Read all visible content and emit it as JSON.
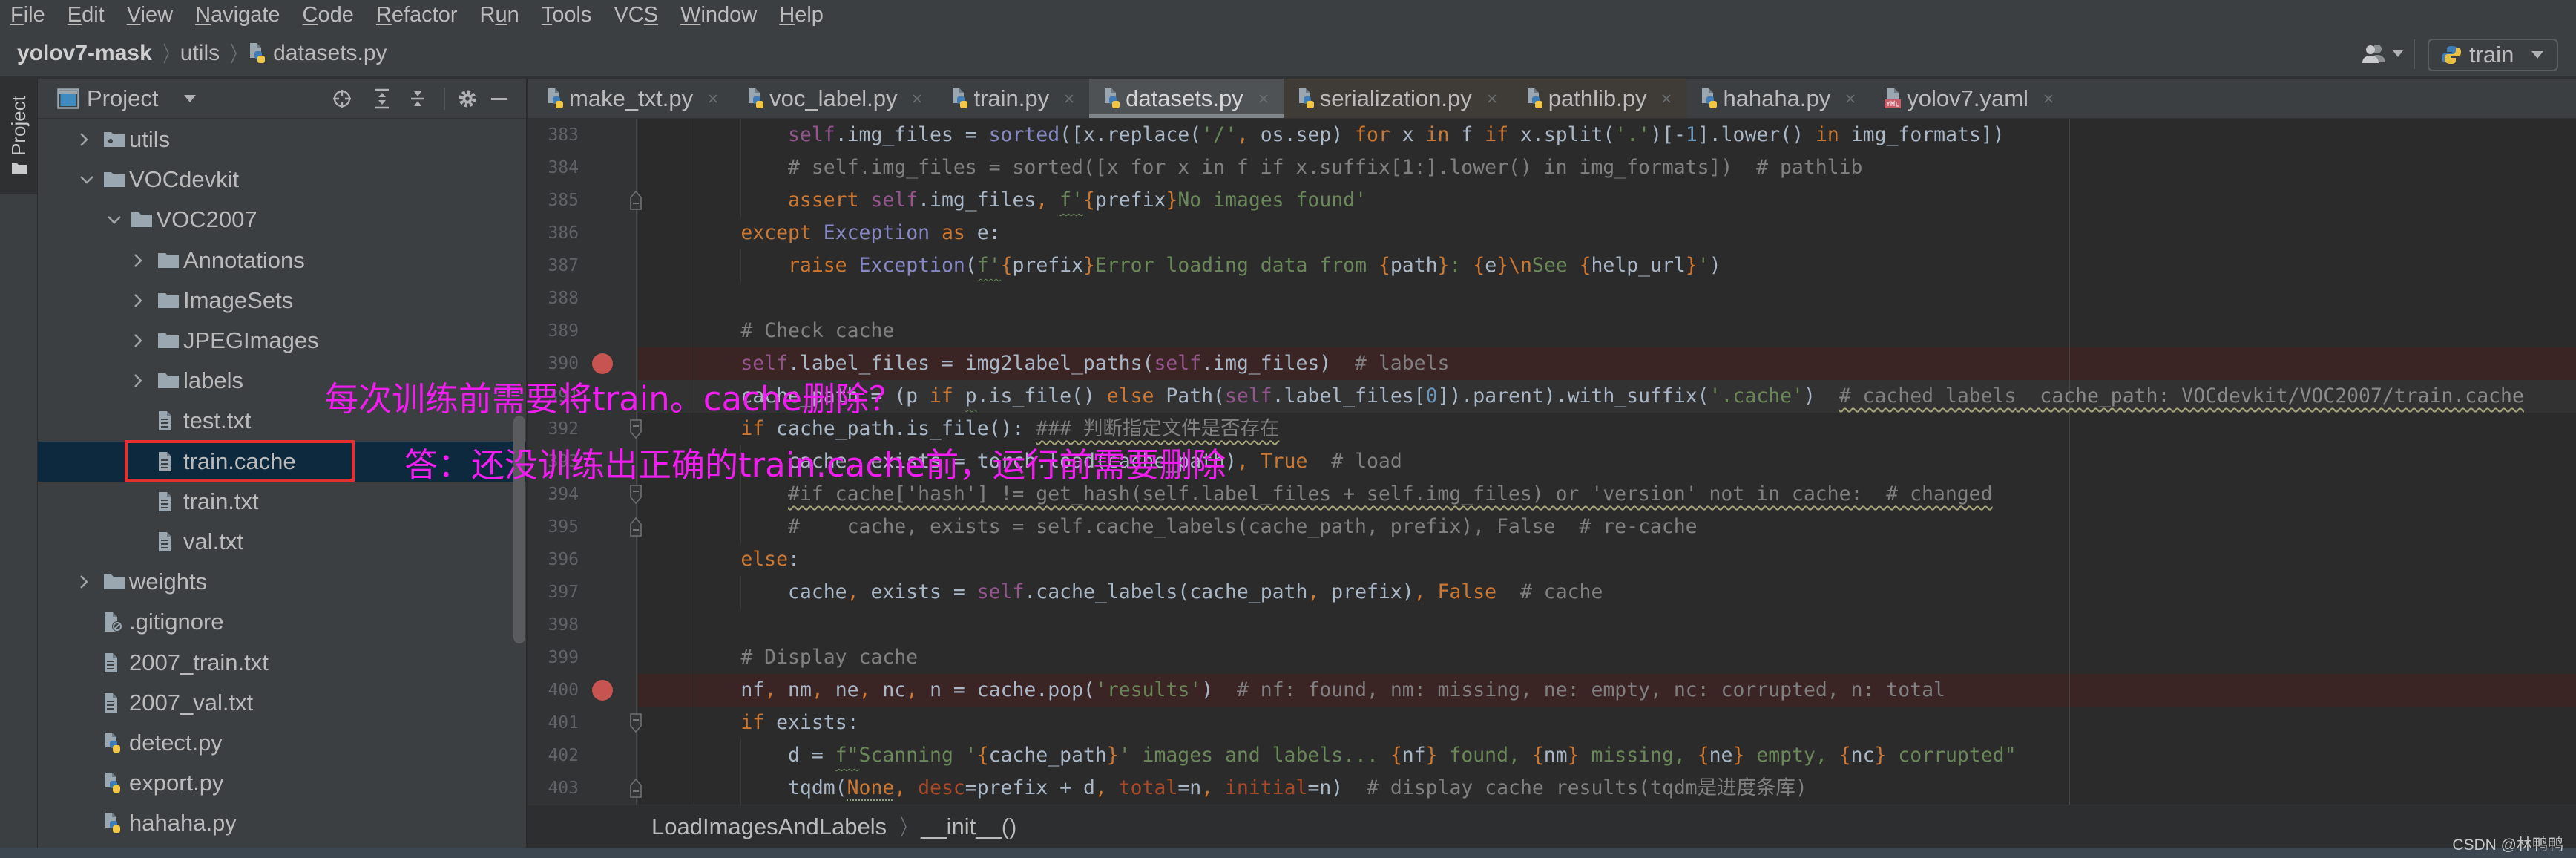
{
  "menu": [
    {
      "label": "File",
      "mnemonic": 0
    },
    {
      "label": "Edit",
      "mnemonic": 0
    },
    {
      "label": "View",
      "mnemonic": 0
    },
    {
      "label": "Navigate",
      "mnemonic": 0
    },
    {
      "label": "Code",
      "mnemonic": 0
    },
    {
      "label": "Refactor",
      "mnemonic": 0
    },
    {
      "label": "Run",
      "mnemonic": 1
    },
    {
      "label": "Tools",
      "mnemonic": 0
    },
    {
      "label": "VCS",
      "mnemonic": 2
    },
    {
      "label": "Window",
      "mnemonic": 0
    },
    {
      "label": "Help",
      "mnemonic": 0
    }
  ],
  "navbar": {
    "project": "yolov7-mask",
    "folder": "utils",
    "file": "datasets.py"
  },
  "toolbar": {
    "run_config": "train"
  },
  "left_strip": {
    "project_tab": "Project"
  },
  "project_panel": {
    "title": "Project",
    "tree": [
      {
        "label": "utils",
        "kind": "package",
        "level": 1,
        "expanded": false
      },
      {
        "label": "VOCdevkit",
        "kind": "folder",
        "level": 1,
        "expanded": true
      },
      {
        "label": "VOC2007",
        "kind": "folder",
        "level": 2,
        "expanded": true
      },
      {
        "label": "Annotations",
        "kind": "folder",
        "level": 3,
        "expanded": false
      },
      {
        "label": "ImageSets",
        "kind": "folder",
        "level": 3,
        "expanded": false
      },
      {
        "label": "JPEGImages",
        "kind": "folder",
        "level": 3,
        "expanded": false
      },
      {
        "label": "labels",
        "kind": "folder",
        "level": 3,
        "expanded": false
      },
      {
        "label": "test.txt",
        "kind": "text",
        "level": 3
      },
      {
        "label": "train.cache",
        "kind": "text",
        "level": 3,
        "selected": true
      },
      {
        "label": "train.txt",
        "kind": "text",
        "level": 3
      },
      {
        "label": "val.txt",
        "kind": "text",
        "level": 3
      },
      {
        "label": "weights",
        "kind": "folder",
        "level": 1,
        "expanded": false
      },
      {
        "label": ".gitignore",
        "kind": "ignore",
        "level": 1
      },
      {
        "label": "2007_train.txt",
        "kind": "text",
        "level": 1
      },
      {
        "label": "2007_val.txt",
        "kind": "text",
        "level": 1
      },
      {
        "label": "detect.py",
        "kind": "python",
        "level": 1
      },
      {
        "label": "export.py",
        "kind": "python",
        "level": 1
      },
      {
        "label": "hahaha.py",
        "kind": "python",
        "level": 1
      }
    ]
  },
  "editor": {
    "tabs": [
      {
        "label": "make_txt.py",
        "icon": "python"
      },
      {
        "label": "voc_label.py",
        "icon": "python"
      },
      {
        "label": "train.py",
        "icon": "python"
      },
      {
        "label": "datasets.py",
        "icon": "python",
        "active": true
      },
      {
        "label": "serialization.py",
        "icon": "python",
        "external": true
      },
      {
        "label": "pathlib.py",
        "icon": "python",
        "external": true
      },
      {
        "label": "hahaha.py",
        "icon": "python"
      },
      {
        "label": "yolov7.yaml",
        "icon": "yaml"
      }
    ],
    "lines": [
      {
        "number": 383,
        "tokens": [
          [
            "            ",
            ""
          ],
          [
            "self",
            "s"
          ],
          [
            ".img_files = ",
            ""
          ],
          [
            "sorted",
            "b"
          ],
          [
            "([x.replace(",
            ""
          ],
          [
            "'/'",
            "str"
          ],
          [
            ",",
            "k"
          ],
          [
            " os.sep) ",
            ""
          ],
          [
            "for",
            "k"
          ],
          [
            " x ",
            ""
          ],
          [
            "in",
            "k"
          ],
          [
            " f ",
            ""
          ],
          [
            "if",
            "k"
          ],
          [
            " x.split(",
            ""
          ],
          [
            "'.'",
            "str"
          ],
          [
            ")[-",
            ""
          ],
          [
            "1",
            "n"
          ],
          [
            "].lower() ",
            ""
          ],
          [
            "in",
            "k"
          ],
          [
            " img_formats])",
            ""
          ]
        ]
      },
      {
        "number": 384,
        "tokens": [
          [
            "            ",
            ""
          ],
          [
            "# self.img_files = sorted([x for x in f if x.suffix[1:].lower() in img_formats])  # pathlib",
            "c"
          ]
        ]
      },
      {
        "number": 385,
        "fold": "end",
        "tokens": [
          [
            "            ",
            ""
          ],
          [
            "assert",
            "k"
          ],
          [
            " ",
            ""
          ],
          [
            "self",
            "s"
          ],
          [
            ".img_files",
            ""
          ],
          [
            ",",
            "k"
          ],
          [
            " ",
            ""
          ],
          [
            "f'",
            "str fw"
          ],
          [
            "{",
            "k"
          ],
          [
            "prefix",
            ""
          ],
          [
            "}",
            "k"
          ],
          [
            "No images found'",
            "str"
          ]
        ]
      },
      {
        "number": 386,
        "tokens": [
          [
            "        ",
            ""
          ],
          [
            "except",
            "k"
          ],
          [
            " ",
            ""
          ],
          [
            "Exception",
            "b"
          ],
          [
            " ",
            ""
          ],
          [
            "as",
            "k"
          ],
          [
            " e:",
            ""
          ]
        ]
      },
      {
        "number": 387,
        "tokens": [
          [
            "            ",
            ""
          ],
          [
            "raise",
            "k"
          ],
          [
            " ",
            ""
          ],
          [
            "Exception",
            "b"
          ],
          [
            "(",
            ""
          ],
          [
            "f'",
            "str fw"
          ],
          [
            "{",
            "k"
          ],
          [
            "prefix",
            ""
          ],
          [
            "}",
            "k"
          ],
          [
            "Error loading data from ",
            "str"
          ],
          [
            "{",
            "k"
          ],
          [
            "path",
            ""
          ],
          [
            "}",
            "k"
          ],
          [
            ": ",
            "str"
          ],
          [
            "{",
            "k"
          ],
          [
            "e",
            ""
          ],
          [
            "}",
            "k"
          ],
          [
            "\\n",
            "k"
          ],
          [
            "See ",
            "str"
          ],
          [
            "{",
            "k"
          ],
          [
            "help_url",
            ""
          ],
          [
            "}",
            "k"
          ],
          [
            "'",
            "str"
          ],
          [
            ")",
            ""
          ]
        ]
      },
      {
        "number": 388,
        "tokens": []
      },
      {
        "number": 389,
        "tokens": [
          [
            "        ",
            ""
          ],
          [
            "# Check cache",
            "c"
          ]
        ]
      },
      {
        "number": 390,
        "breakpoint": true,
        "tokens": [
          [
            "        ",
            ""
          ],
          [
            "self",
            "s"
          ],
          [
            ".label_files = img2label_paths(",
            ""
          ],
          [
            "self",
            "s"
          ],
          [
            ".img_files)  ",
            ""
          ],
          [
            "# labels",
            "c"
          ]
        ]
      },
      {
        "number": 391,
        "current": true,
        "tokens": [
          [
            "        ",
            ""
          ],
          [
            "cache_path = (p ",
            ""
          ],
          [
            "if",
            "k"
          ],
          [
            " ",
            ""
          ],
          [
            "p",
            "fw"
          ],
          [
            ".is_file() ",
            ""
          ],
          [
            "else",
            "k"
          ],
          [
            " Path(",
            ""
          ],
          [
            "self",
            "s"
          ],
          [
            ".label_files[",
            ""
          ],
          [
            "0",
            "n"
          ],
          [
            "]).parent).with_suffix(",
            ""
          ],
          [
            "'.cache'",
            "str"
          ],
          [
            ")  ",
            ""
          ],
          [
            "# cached labels",
            "c wavy"
          ],
          [
            "  cache_path: VOCdevkit/VOC2007/train.cache",
            "hint wavy"
          ]
        ]
      },
      {
        "number": 392,
        "fold": "start",
        "tokens": [
          [
            "        ",
            ""
          ],
          [
            "if",
            "k"
          ],
          [
            " cache_path.is_file(): ",
            ""
          ],
          [
            "### 判断指定文件是否存在",
            "c wavy"
          ]
        ]
      },
      {
        "number": 393,
        "tokens": [
          [
            "            ",
            ""
          ],
          [
            "cache",
            ""
          ],
          [
            ",",
            "k"
          ],
          [
            " exists = torch.load(cache_path)",
            ""
          ],
          [
            ",",
            "k"
          ],
          [
            " ",
            ""
          ],
          [
            "True",
            "k"
          ],
          [
            "  ",
            ""
          ],
          [
            "# load",
            "c"
          ]
        ]
      },
      {
        "number": 394,
        "fold": "start",
        "tokens": [
          [
            "            ",
            ""
          ],
          [
            "#if cache['hash'] != get_hash(self.label_files + self.img_files) or 'version' not in cache:  # changed",
            "c wavy"
          ]
        ]
      },
      {
        "number": 395,
        "fold": "end",
        "tokens": [
          [
            "            ",
            ""
          ],
          [
            "#    cache, exists = self.cache_labels(cache_path, prefix), False  # re-cache",
            "c"
          ]
        ]
      },
      {
        "number": 396,
        "tokens": [
          [
            "        ",
            ""
          ],
          [
            "else",
            "k"
          ],
          [
            ":",
            ""
          ]
        ]
      },
      {
        "number": 397,
        "tokens": [
          [
            "            ",
            ""
          ],
          [
            "cache",
            ""
          ],
          [
            ",",
            "k"
          ],
          [
            " exists = ",
            ""
          ],
          [
            "self",
            "s"
          ],
          [
            ".cache_labels(cache_path",
            ""
          ],
          [
            ",",
            "k"
          ],
          [
            " prefix)",
            ""
          ],
          [
            ",",
            "k"
          ],
          [
            " ",
            ""
          ],
          [
            "False",
            "k"
          ],
          [
            "  ",
            ""
          ],
          [
            "# cache",
            "c"
          ]
        ]
      },
      {
        "number": 398,
        "tokens": []
      },
      {
        "number": 399,
        "tokens": [
          [
            "        ",
            ""
          ],
          [
            "# Display cache",
            "c"
          ]
        ]
      },
      {
        "number": 400,
        "breakpoint": true,
        "tokens": [
          [
            "        ",
            ""
          ],
          [
            "nf",
            ""
          ],
          [
            ",",
            "k"
          ],
          [
            " nm",
            ""
          ],
          [
            ",",
            "k"
          ],
          [
            " ne",
            ""
          ],
          [
            ",",
            "k"
          ],
          [
            " nc",
            ""
          ],
          [
            ",",
            "k"
          ],
          [
            " n = cache.pop(",
            ""
          ],
          [
            "'results'",
            "str"
          ],
          [
            ")  ",
            ""
          ],
          [
            "# nf: found, nm: missing, ne: empty, nc: corrupted, n: total",
            "c"
          ]
        ]
      },
      {
        "number": 401,
        "fold": "start",
        "tokens": [
          [
            "        ",
            ""
          ],
          [
            "if",
            "k"
          ],
          [
            " exists:",
            ""
          ]
        ]
      },
      {
        "number": 402,
        "tokens": [
          [
            "            ",
            ""
          ],
          [
            "d = ",
            ""
          ],
          [
            "f\"",
            "str fw"
          ],
          [
            "Scanning '",
            "str"
          ],
          [
            "{",
            "k"
          ],
          [
            "cache_path",
            ""
          ],
          [
            "}",
            "k"
          ],
          [
            "' images and labels... ",
            "str"
          ],
          [
            "{",
            "k"
          ],
          [
            "nf",
            ""
          ],
          [
            "}",
            "k"
          ],
          [
            " found, ",
            "str"
          ],
          [
            "{",
            "k"
          ],
          [
            "nm",
            ""
          ],
          [
            "}",
            "k"
          ],
          [
            " missing, ",
            "str"
          ],
          [
            "{",
            "k"
          ],
          [
            "ne",
            ""
          ],
          [
            "}",
            "k"
          ],
          [
            " empty, ",
            "str"
          ],
          [
            "{",
            "k"
          ],
          [
            "nc",
            ""
          ],
          [
            "}",
            "k"
          ],
          [
            " corrupted\"",
            "str"
          ]
        ]
      },
      {
        "number": 403,
        "fold": "end",
        "tokens": [
          [
            "            ",
            ""
          ],
          [
            "tqdm(",
            ""
          ],
          [
            "None",
            "k dot"
          ],
          [
            ",",
            "k"
          ],
          [
            " ",
            ""
          ],
          [
            "desc",
            "arg"
          ],
          [
            "=prefix + d",
            ""
          ],
          [
            ",",
            "k"
          ],
          [
            " ",
            ""
          ],
          [
            "total",
            "arg"
          ],
          [
            "=n",
            ""
          ],
          [
            ",",
            "k"
          ],
          [
            " ",
            ""
          ],
          [
            "initial",
            "arg"
          ],
          [
            "=n)  ",
            ""
          ],
          [
            "# display cache results(tqdm是进度条库)",
            "c"
          ]
        ]
      }
    ],
    "breadcrumb": [
      "LoadImagesAndLabels",
      "__init__()"
    ]
  },
  "annotations": {
    "question": "每次训练前需要将train。cache删除？",
    "answer": "答：还没训练出正确的train.cache前，运行前需要删除"
  },
  "watermark": "CSDN @林鸭鸭",
  "colors": {
    "annotation": "#F01CF0",
    "highlight_box": "#E5302F",
    "breakpoint": "#C75450",
    "selection": "#0D293E",
    "active_tab": "#4E5254"
  }
}
